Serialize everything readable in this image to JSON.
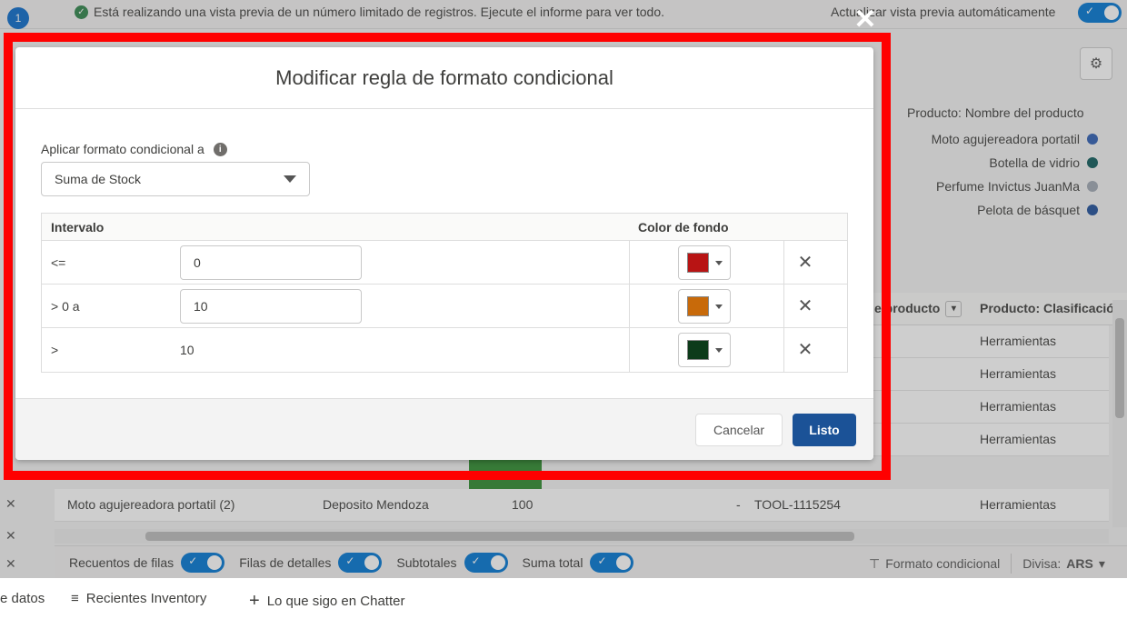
{
  "topbar": {
    "count_badge": "1",
    "preview_message": "Está realizando una vista previa de un número limitado de registros. Ejecute el informe para ver todo.",
    "auto_preview_label": "Actualizar vista previa automáticamente"
  },
  "legend": {
    "title": "Producto: Nombre del producto",
    "items": [
      {
        "label": "Moto agujereadora portatil",
        "color": "#2f5fb3"
      },
      {
        "label": "Botella de vidrio",
        "color": "#0e5c5c"
      },
      {
        "label": "Perfume Invictus JuanMa",
        "color": "#a0a8b3"
      },
      {
        "label": "Pelota de básquet",
        "color": "#1f4f9a"
      }
    ]
  },
  "table": {
    "header_product": "e producto",
    "header_class": "Producto: Clasificació",
    "class_rows": [
      "Herramientas",
      "Herramientas",
      "Herramientas",
      "Herramientas"
    ],
    "last_row": {
      "name": "Moto agujereadora portatil (2)",
      "warehouse": "Deposito Mendoza",
      "qty": "100",
      "dash": "-",
      "code": "TOOL-1115254",
      "class": "Herramientas"
    }
  },
  "footer_bar": {
    "row_counts": "Recuentos de filas",
    "detail_rows": "Filas de detalles",
    "subtotals": "Subtotales",
    "grand_total": "Suma total",
    "cond_format": "Formato condicional",
    "currency_label": "Divisa:",
    "currency_value": "ARS"
  },
  "appbar": {
    "item1": "e datos",
    "item2": "Recientes Inventory",
    "item3": "Lo que sigo en Chatter"
  },
  "modal": {
    "title": "Modificar regla de formato condicional",
    "apply_label": "Aplicar formato condicional a",
    "apply_value": "Suma de Stock",
    "col_interval": "Intervalo",
    "col_color": "Color de fondo",
    "rules": [
      {
        "op": "<=",
        "value": "0",
        "editable": true,
        "color": "#b81414"
      },
      {
        "op": "> 0 a",
        "value": "10",
        "editable": true,
        "color": "#c86a0a"
      },
      {
        "op": ">",
        "value": "10",
        "editable": false,
        "color": "#0d3b1a"
      }
    ],
    "cancel_label": "Cancelar",
    "done_label": "Listo"
  }
}
